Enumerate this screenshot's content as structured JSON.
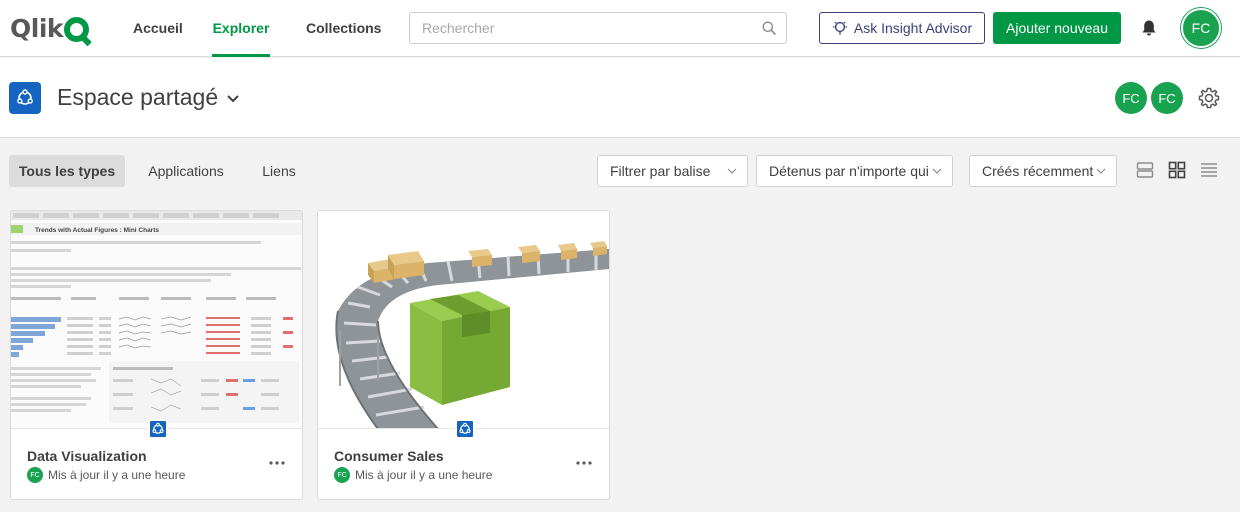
{
  "nav": {
    "logo": "Qlik",
    "links": [
      {
        "label": "Accueil"
      },
      {
        "label": "Explorer"
      },
      {
        "label": "Collections"
      }
    ],
    "search_placeholder": "Rechercher",
    "insight_label": "Ask Insight Advisor",
    "add_label": "Ajouter nouveau",
    "user_initials": "FC",
    "active_link": "Explorer"
  },
  "space": {
    "title": "Espace partagé",
    "members": [
      "FC",
      "FC"
    ]
  },
  "toolbar": {
    "tabs": [
      {
        "label": "Tous les types"
      },
      {
        "label": "Applications"
      },
      {
        "label": "Liens"
      }
    ],
    "active_tab": "Tous les types",
    "filters": [
      {
        "label": "Filtrer par balise"
      },
      {
        "label": "Détenus par n'importe qui"
      },
      {
        "label": "Créés récemment"
      }
    ],
    "view_mode": "grid"
  },
  "cards": [
    {
      "title": "Data Visualization",
      "owner": "FC",
      "updated": "Mis à jour il y a une heure",
      "thumb_heading": "Trends with Actual Figures : Mini Charts"
    },
    {
      "title": "Consumer Sales",
      "owner": "FC",
      "updated": "Mis à jour il y a une heure"
    }
  ],
  "colors": {
    "brand_green": "#009845",
    "avatar_green": "#19a351",
    "space_blue": "#1565c0",
    "insight_navy": "#3a3f7a"
  }
}
